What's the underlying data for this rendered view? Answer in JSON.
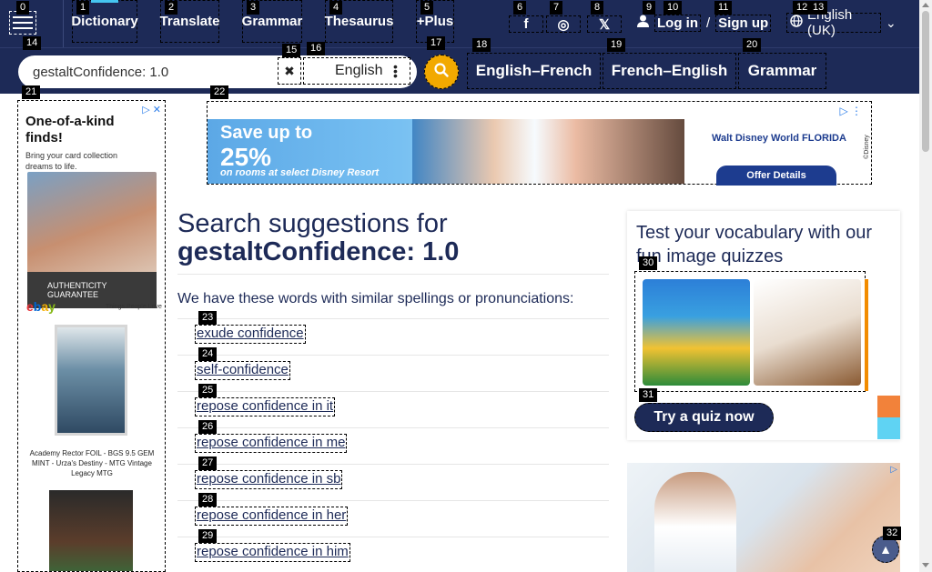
{
  "nav": {
    "items": [
      {
        "label": "Dictionary",
        "badge": "1"
      },
      {
        "label": "Translate",
        "badge": "2"
      },
      {
        "label": "Grammar",
        "badge": "3"
      },
      {
        "label": "Thesaurus",
        "badge": "4"
      },
      {
        "label": "+Plus",
        "badge": "5"
      }
    ],
    "menu_badge": "0",
    "social": [
      {
        "icon": "facebook-icon",
        "glyph": "f",
        "badge": "6"
      },
      {
        "icon": "instagram-icon",
        "glyph": "◎",
        "badge": "7"
      },
      {
        "icon": "x-icon",
        "glyph": "𝕏",
        "badge": "8"
      }
    ],
    "login": {
      "user_badge": "9",
      "login_label": "Log in",
      "login_badge": "10",
      "slash": "/",
      "signup_label": "Sign up",
      "signup_badge": "11"
    },
    "language": {
      "label": "English (UK)",
      "badge_a": "12",
      "badge_b": "13"
    }
  },
  "search": {
    "value": "gestaltConfidence: 1.0",
    "badge": "14",
    "clear_badge": "15",
    "dictionary_label": "English",
    "dictionary_badge": "16",
    "submit_badge": "17"
  },
  "subnav": [
    {
      "label": "English–French",
      "badge": "18"
    },
    {
      "label": "French–English",
      "badge": "19"
    },
    {
      "label": "Grammar",
      "badge": "20"
    }
  ],
  "ads": {
    "left_badge": "21",
    "left_heading": "One-of-a-kind finds!",
    "left_sub": "Bring your card collection dreams to life.",
    "left_auth": "AUTHENTICITY GUARANTEE",
    "left_ebay": [
      "e",
      "b",
      "a",
      "y"
    ],
    "left_tagline": "Things.People.Love",
    "left_caption": "Academy Rector FOIL - BGS 9.5 GEM MINT - Urza's Destiny - MTG Vintage Legacy MTG",
    "top_badge": "22",
    "top_heading": "Save up to",
    "top_big": "25%",
    "top_sub": "on rooms at select Disney Resort",
    "top_brand": "Walt Disney World FLORIDA",
    "top_offer": "Offer Details",
    "top_disclaimer": "©Disney"
  },
  "main": {
    "title_prefix": "Search suggestions for",
    "title_term": "gestaltConfidence: 1.0",
    "intro": "We have these words with similar spellings or pronunciations:",
    "suggestions": [
      {
        "label": "exude confidence",
        "badge": "23"
      },
      {
        "label": "self-confidence",
        "badge": "24"
      },
      {
        "label": "repose confidence in it",
        "badge": "25"
      },
      {
        "label": "repose confidence in me",
        "badge": "26"
      },
      {
        "label": "repose confidence in sb",
        "badge": "27"
      },
      {
        "label": "repose confidence in her",
        "badge": "28"
      },
      {
        "label": "repose confidence in him",
        "badge": "29"
      }
    ]
  },
  "quiz": {
    "title": "Test your vocabulary with our fun image quizzes",
    "image_badge": "30",
    "button_label": "Try a quiz now",
    "button_badge": "31"
  },
  "to_top_badge": "32"
}
